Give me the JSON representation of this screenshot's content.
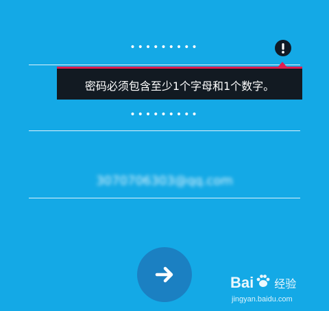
{
  "password_field": {
    "masked_value": "•••••••••"
  },
  "error_tooltip": {
    "message": "密码必须包含至少1个字母和1个数字。"
  },
  "confirm_password_field": {
    "masked_value": "•••••••••"
  },
  "email_field": {
    "value": "3070706303@qq.com"
  },
  "next_button": {
    "icon": "arrow-right-icon"
  },
  "watermark": {
    "brand_left": "Bai",
    "brand_right": "经验",
    "url": "jingyan.baidu.com"
  },
  "colors": {
    "background": "#14a9e6",
    "tooltip_bg": "#121a22",
    "tooltip_accent": "#e01c4f",
    "button_bg": "#1b80c2"
  }
}
